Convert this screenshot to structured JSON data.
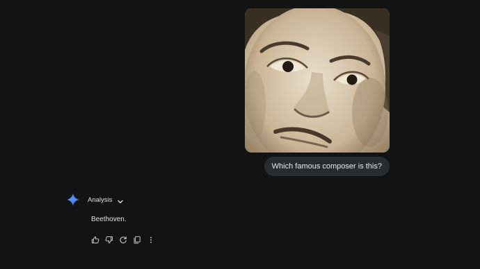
{
  "conversation": {
    "user_image": {
      "icon": "portrait-photo",
      "tone_colors": [
        "#e2d7c2",
        "#b8a587",
        "#5a4a37",
        "#231a12"
      ]
    },
    "user_message": "Which famous composer is this?",
    "model": {
      "icon": "gemini-sparkle-icon",
      "accent_color": "#4c8df6",
      "analysis_label": "Analysis",
      "response_text": "Beethoven."
    },
    "actions": [
      {
        "icon": "thumbs-up-icon"
      },
      {
        "icon": "thumbs-down-icon"
      },
      {
        "icon": "regenerate-icon"
      },
      {
        "icon": "copy-icon"
      },
      {
        "icon": "more-options-icon"
      }
    ]
  }
}
